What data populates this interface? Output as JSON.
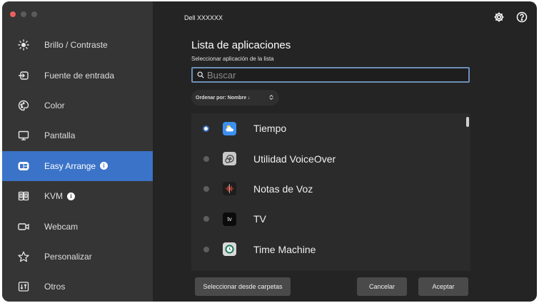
{
  "window": {
    "monitor_name": "Dell XXXXXX"
  },
  "sidebar": {
    "items": [
      {
        "label": "Brillo / Contraste",
        "icon": "brightness-icon",
        "info": false
      },
      {
        "label": "Fuente de entrada",
        "icon": "input-source-icon",
        "info": false
      },
      {
        "label": "Color",
        "icon": "color-palette-icon",
        "info": false
      },
      {
        "label": "Pantalla",
        "icon": "display-icon",
        "info": false
      },
      {
        "label": "Easy Arrange",
        "icon": "easy-arrange-icon",
        "info": true,
        "active": true
      },
      {
        "label": "KVM",
        "icon": "kvm-icon",
        "info": true
      },
      {
        "label": "Webcam",
        "icon": "webcam-icon",
        "info": false
      },
      {
        "label": "Personalizar",
        "icon": "star-icon",
        "info": false
      },
      {
        "label": "Otros",
        "icon": "others-icon",
        "info": false
      }
    ]
  },
  "main": {
    "title": "Lista de aplicaciones",
    "subtitle": "Seleccionar aplicación de la lista",
    "search": {
      "placeholder": "Buscar",
      "value": ""
    },
    "sort": {
      "label": "Ordenar por: Nombre ↓"
    },
    "apps": [
      {
        "name": "Tiempo",
        "selected": true
      },
      {
        "name": "Utilidad VoiceOver",
        "selected": false
      },
      {
        "name": "Notas de Voz",
        "selected": false
      },
      {
        "name": "TV",
        "selected": false
      },
      {
        "name": "Time Machine",
        "selected": false
      }
    ],
    "buttons": {
      "folders": "Seleccionar desde carpetas",
      "cancel": "Cancelar",
      "accept": "Aceptar"
    }
  },
  "colors": {
    "accent": "#3b73c8",
    "sidebar_bg": "#353535",
    "main_bg": "#242424"
  }
}
